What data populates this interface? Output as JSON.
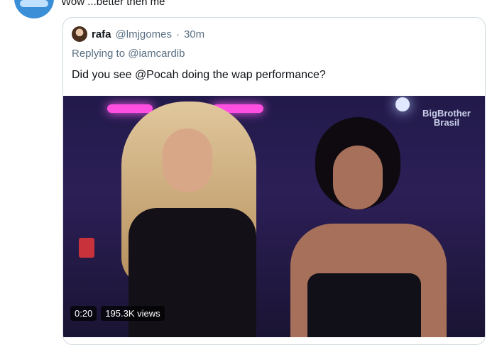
{
  "reply": {
    "text": "Wow ...better then me"
  },
  "quote": {
    "author_name": "rafa",
    "author_handle": "@lmjgomes",
    "separator": "·",
    "time": "30m",
    "replying_to": "Replying to @iamcardib",
    "text": "Did you see @Pocah doing the wap performance?"
  },
  "video": {
    "watermark_line1": "BigBrother",
    "watermark_line2": "Brasil",
    "duration": "0:20",
    "views": "195.3K views"
  }
}
